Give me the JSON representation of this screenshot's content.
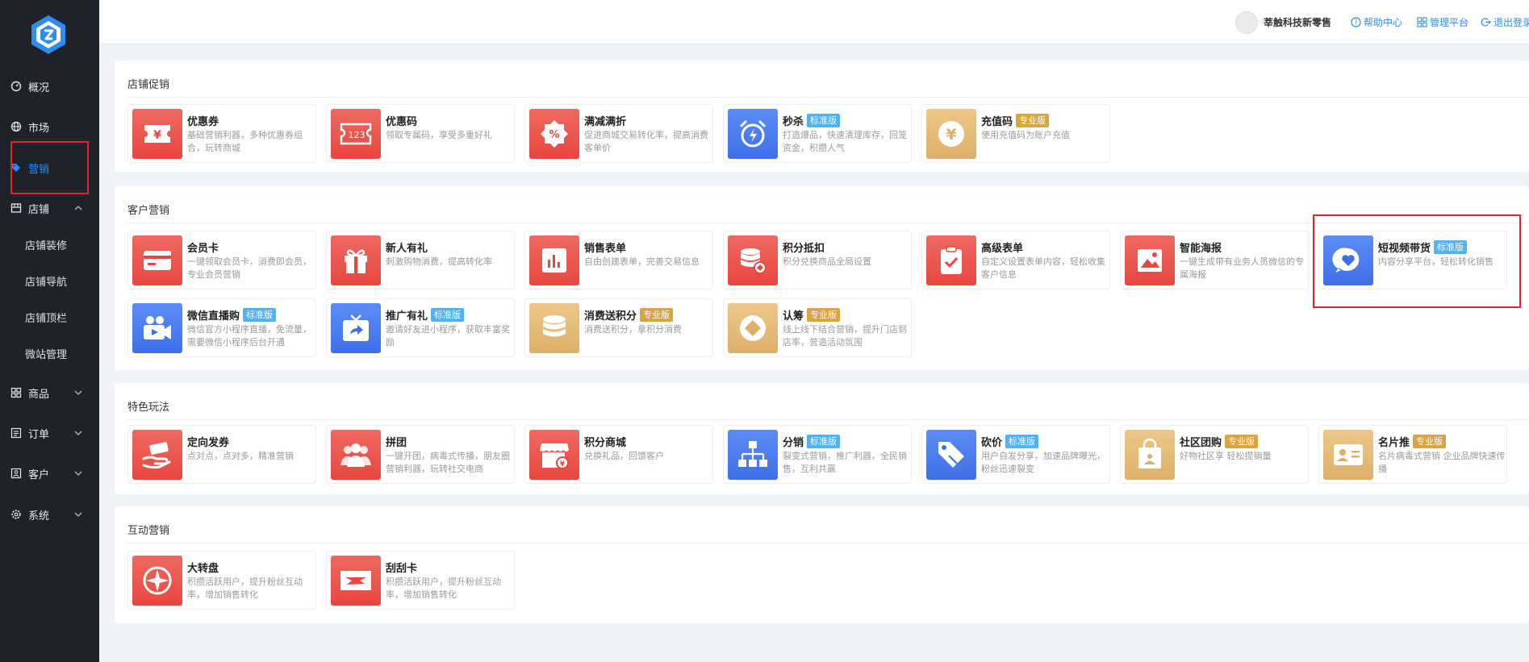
{
  "sidebar": {
    "items": [
      {
        "label": "概况",
        "icon": "gauge-icon",
        "active": false
      },
      {
        "label": "市场",
        "icon": "globe-icon",
        "active": false
      },
      {
        "label": "营销",
        "icon": "tag-icon",
        "active": true
      },
      {
        "label": "店铺",
        "icon": "store-icon",
        "active": false,
        "expanded": true,
        "children": [
          "店铺装修",
          "店铺导航",
          "店铺顶栏",
          "微站管理"
        ]
      },
      {
        "label": "商品",
        "icon": "grid-icon",
        "active": false
      },
      {
        "label": "订单",
        "icon": "list-icon",
        "active": false
      },
      {
        "label": "客户",
        "icon": "user-icon",
        "active": false
      },
      {
        "label": "系统",
        "icon": "gear-icon",
        "active": false
      }
    ]
  },
  "header": {
    "store_name": "莘触科技新零售",
    "help_label": "帮助中心",
    "admin_label": "管理平台",
    "logout_label": "退出登录"
  },
  "badges": {
    "standard": "标准版",
    "pro": "专业版"
  },
  "colors": {
    "accent": "#2d8cf0",
    "red_tile": "#e8463f",
    "blue_tile": "#3f6fe8",
    "gold_tile": "#ddb06a",
    "badge_std": "#4fb3f6",
    "badge_pro": "#dba43f"
  },
  "sections": [
    {
      "title": "店铺促销",
      "cards": [
        {
          "name": "优惠券",
          "desc": "基础营销利器，多种优惠券组合，玩转商城",
          "tile": "red",
          "icon": "ticket-icon"
        },
        {
          "name": "优惠码",
          "desc": "领取专属码，享受多重好礼",
          "tile": "red",
          "icon": "code-ticket-icon"
        },
        {
          "name": "满减满折",
          "desc": "促进商城交易转化率，提高消费客单价",
          "tile": "red",
          "icon": "percent-icon"
        },
        {
          "name": "秒杀",
          "badge": "标准版",
          "desc": "打造爆品，快速清理库存，回笼资金，积攒人气",
          "tile": "blue",
          "icon": "alarm-icon"
        },
        {
          "name": "充值码",
          "badge": "专业版",
          "desc": "使用充值码为账户充值",
          "tile": "gold",
          "icon": "yen-coin-icon"
        }
      ]
    },
    {
      "title": "客户营销",
      "cards": [
        {
          "name": "会员卡",
          "desc": "一键领取会员卡，消费即会员，专业会员营销",
          "tile": "red",
          "icon": "card-icon"
        },
        {
          "name": "新人有礼",
          "desc": "刺激购物消费，提高转化率",
          "tile": "red",
          "icon": "gift-icon"
        },
        {
          "name": "销售表单",
          "desc": "自由创建表单，完善交易信息",
          "tile": "red",
          "icon": "bar-chart-icon"
        },
        {
          "name": "积分抵扣",
          "desc": "积分兑换商品全局设置",
          "tile": "red",
          "icon": "coins-icon"
        },
        {
          "name": "高级表单",
          "desc": "自定义设置表单内容，轻松收集客户信息",
          "tile": "red",
          "icon": "clipboard-icon"
        },
        {
          "name": "智能海报",
          "desc": "一键生成带有业务人员微信的专属海报",
          "tile": "red",
          "icon": "poster-icon"
        },
        {
          "name": "短视频带货",
          "badge": "标准版",
          "desc": "内容分享平台，轻松转化销售",
          "tile": "blue",
          "icon": "heart-chat-icon"
        },
        {
          "name": "微信直播购",
          "badge": "标准版",
          "desc": "微信官方小程序直播，免流量，需要微信小程序后台开通",
          "tile": "blue",
          "icon": "video-camera-icon"
        },
        {
          "name": "推广有礼",
          "badge": "标准版",
          "desc": "邀请好友进小程序，获取丰富奖励",
          "tile": "blue",
          "icon": "share-tv-icon"
        },
        {
          "name": "消费送积分",
          "badge": "专业版",
          "desc": "消费送积分，拿积分消费",
          "tile": "gold",
          "icon": "coin-stack-icon"
        },
        {
          "name": "认筹",
          "badge": "专业版",
          "desc": "线上线下结合营销，提升门店到店率，营造活动氛围",
          "tile": "gold",
          "icon": "diamond-coin-icon"
        }
      ]
    },
    {
      "title": "特色玩法",
      "cards": [
        {
          "name": "定向发券",
          "desc": "点对点，点对多，精准营销",
          "tile": "red",
          "icon": "hand-ticket-icon"
        },
        {
          "name": "拼团",
          "desc": "一键开团，病毒式传播，朋友圈营销利器，玩转社交电商",
          "tile": "red",
          "icon": "group-icon"
        },
        {
          "name": "积分商城",
          "desc": "兑换礼品，回馈客户",
          "tile": "red",
          "icon": "shop-icon"
        },
        {
          "name": "分销",
          "badge": "标准版",
          "desc": "裂变式营销，推广利器，全民销售，互利共赢",
          "tile": "blue",
          "icon": "hierarchy-icon"
        },
        {
          "name": "砍价",
          "badge": "标准版",
          "desc": "用户自发分享，加速品牌曝光，粉丝迅速裂变",
          "tile": "blue",
          "icon": "price-tag-icon"
        },
        {
          "name": "社区团购",
          "badge": "专业版",
          "desc": "好物社区享 轻松提销量",
          "tile": "gold",
          "icon": "bag-icon"
        },
        {
          "name": "名片推",
          "badge": "专业版",
          "desc": "名片病毒式营销 企业品牌快速传播",
          "tile": "gold",
          "icon": "business-card-icon"
        }
      ]
    },
    {
      "title": "互动营销",
      "cards": [
        {
          "name": "大转盘",
          "desc": "积攒活跃用户，提升粉丝互动率，增加销售转化",
          "tile": "red",
          "icon": "wheel-icon"
        },
        {
          "name": "刮刮卡",
          "desc": "积攒活跃用户，提升粉丝互动率，增加销售转化",
          "tile": "red",
          "icon": "scratch-card-icon"
        }
      ]
    }
  ]
}
